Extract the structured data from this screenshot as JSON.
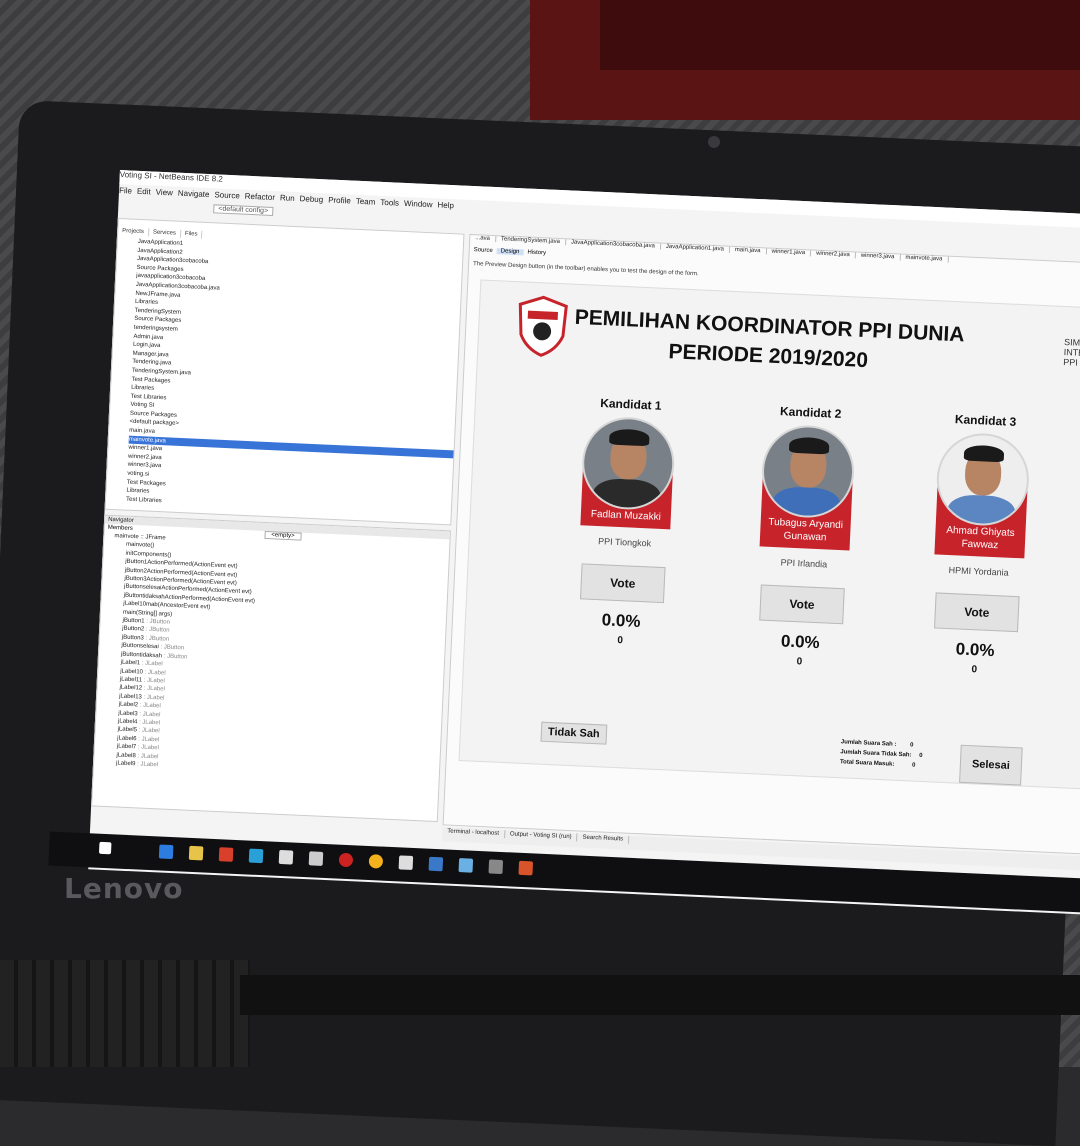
{
  "laptop": {
    "brand": "Lenovo"
  },
  "ide": {
    "title": "Voting SI - NetBeans IDE 8.2",
    "menu": [
      "File",
      "Edit",
      "View",
      "Navigate",
      "Source",
      "Refactor",
      "Run",
      "Debug",
      "Profile",
      "Team",
      "Tools",
      "Window",
      "Help"
    ],
    "config": "<default config>",
    "project_tabs": [
      "Projects",
      "Services",
      "Files"
    ],
    "tree": [
      "JavaApplication1",
      "JavaApplication2",
      "JavaApplication3cobacoba",
      "Source Packages",
      "javaapplication3cobacoba",
      "JavaApplication3cobacoba.java",
      "NewJFrame.java",
      "Libraries",
      "TenderingSystem",
      "Source Packages",
      "tenderingsystem",
      "Admin.java",
      "Login.java",
      "Manager.java",
      "Tendering.java",
      "TenderingSystem.java",
      "Test Packages",
      "Libraries",
      "Test Libraries",
      "Voting SI",
      "Source Packages",
      "<default package>",
      "main.java",
      "mainvote.java",
      "winner1.java",
      "winner2.java",
      "winner3.java",
      "voting.si",
      "Test Packages",
      "Libraries",
      "Test Libraries"
    ],
    "tree_selected": "mainvote.java",
    "navigator": {
      "tab": "Navigator",
      "members_label": "Members",
      "filter": "<empty>",
      "root": "mainvote :: JFrame",
      "members": [
        {
          "name": "mainvote()",
          "type": ""
        },
        {
          "name": "initComponents()",
          "type": ""
        },
        {
          "name": "jButton1ActionPerformed(ActionEvent evt)",
          "type": ""
        },
        {
          "name": "jButton2ActionPerformed(ActionEvent evt)",
          "type": ""
        },
        {
          "name": "jButton3ActionPerformed(ActionEvent evt)",
          "type": ""
        },
        {
          "name": "jButtonselesaiActionPerformed(ActionEvent evt)",
          "type": ""
        },
        {
          "name": "jButtontidaksahActionPerformed(ActionEvent evt)",
          "type": ""
        },
        {
          "name": "jLabel10mab(AncestorEvent evt)",
          "type": ""
        },
        {
          "name": "main(String[] args)",
          "type": ""
        },
        {
          "name": "jButton1",
          "type": ": JButton"
        },
        {
          "name": "jButton2",
          "type": ": JButton"
        },
        {
          "name": "jButton3",
          "type": ": JButton"
        },
        {
          "name": "jButtonselesai",
          "type": ": JButton"
        },
        {
          "name": "jButtontidaksah",
          "type": ": JButton"
        },
        {
          "name": "jLabel1",
          "type": ": JLabel"
        },
        {
          "name": "jLabel10",
          "type": ": JLabel"
        },
        {
          "name": "jLabel11",
          "type": ": JLabel"
        },
        {
          "name": "jLabel12",
          "type": ": JLabel"
        },
        {
          "name": "jLabel13",
          "type": ": JLabel"
        },
        {
          "name": "jLabel2",
          "type": ": JLabel"
        },
        {
          "name": "jLabel3",
          "type": ": JLabel"
        },
        {
          "name": "jLabel4",
          "type": ": JLabel"
        },
        {
          "name": "jLabel5",
          "type": ": JLabel"
        },
        {
          "name": "jLabel6",
          "type": ": JLabel"
        },
        {
          "name": "jLabel7",
          "type": ": JLabel"
        },
        {
          "name": "jLabel8",
          "type": ": JLabel"
        },
        {
          "name": "jLabel9",
          "type": ": JLabel"
        }
      ]
    },
    "editor_tabs": [
      "...ava",
      "TenderingSystem.java",
      "JavaApplication3cobacoba.java",
      "JavaApplication1.java",
      "main.java",
      "winner1.java",
      "winner2.java",
      "winner3.java",
      "mainvote.java"
    ],
    "editor_subtabs": [
      "Source",
      "Design",
      "History"
    ],
    "hint": "The Preview Design button (in the toolbar) enables you to test the design of the form.",
    "output_tabs": [
      "Terminal - localhost",
      "Output - Voting SI (run)",
      "Search Results"
    ]
  },
  "form": {
    "title_line1": "PEMILIHAN KOORDINATOR PPI DUNIA",
    "title_line2": "PERIODE 2019/2020",
    "logo_right": "SIMPO INTERNAS PPI DUNI",
    "candidates": [
      {
        "label": "Kandidat 1",
        "name": "Fadlan Muzakki",
        "org": "PPI Tiongkok",
        "vote": "Vote",
        "percent": "0.0%",
        "count": "0"
      },
      {
        "label": "Kandidat 2",
        "name": "Tubagus Aryandi Gunawan",
        "org": "PPI Irlandia",
        "vote": "Vote",
        "percent": "0.0%",
        "count": "0"
      },
      {
        "label": "Kandidat 3",
        "name": "Ahmad Ghiyats Fawwaz",
        "org": "HPMI Yordania",
        "vote": "Vote",
        "percent": "0.0%",
        "count": "0"
      }
    ],
    "tidak_sah": "Tidak Sah",
    "stats": [
      {
        "label": "Jumlah Suara Sah :",
        "value": "0"
      },
      {
        "label": "Jumlah Suara Tidak Sah:",
        "value": "0"
      },
      {
        "label": "Total Suara Masuk:",
        "value": "0"
      }
    ],
    "selesai": "Selesai"
  },
  "colors": {
    "accent_red": "#c7232b",
    "selection_blue": "#3874d8"
  }
}
